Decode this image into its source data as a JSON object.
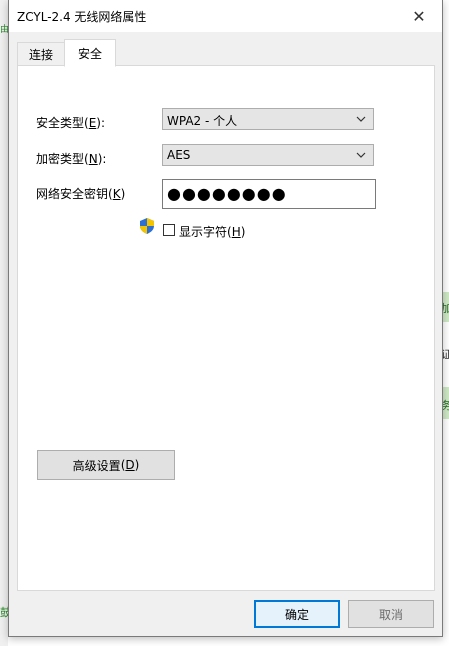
{
  "window": {
    "title": "ZCYL-2.4 无线网络属性",
    "close_glyph": "✕"
  },
  "tabs": [
    {
      "label": "连接",
      "active": false
    },
    {
      "label": "安全",
      "active": true
    }
  ],
  "security_type": {
    "label": "安全类型",
    "accel": "E",
    "value": "WPA2 - 个人"
  },
  "encryption_type": {
    "label": "加密类型",
    "accel": "N",
    "value": "AES"
  },
  "network_key": {
    "label": "网络安全密钥",
    "accel": "K",
    "value": "●●●●●●●●"
  },
  "show_chars": {
    "label": "显示字符",
    "accel": "H",
    "checked": false
  },
  "advanced_button": {
    "label": "高级设置",
    "accel": "D"
  },
  "footer": {
    "ok_label": "确定",
    "cancel_label": "取消"
  },
  "background": {
    "side_glyphs": [
      "加",
      "证",
      "务"
    ],
    "left_glyphs": [
      "由",
      "鼓"
    ]
  },
  "colors": {
    "accent": "#0078d7",
    "shield_blue": "#2f6fd1",
    "shield_yellow": "#f5c400"
  }
}
